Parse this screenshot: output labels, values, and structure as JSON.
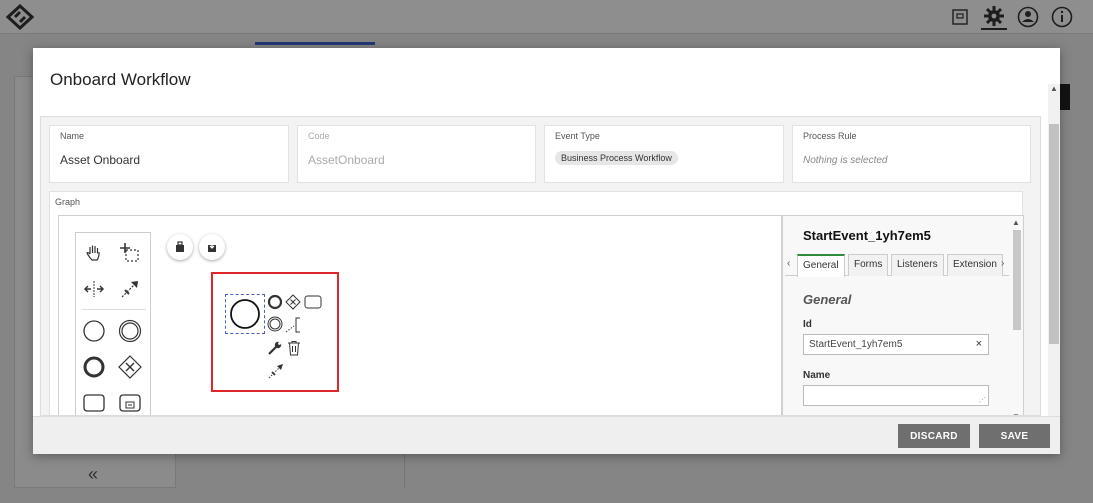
{
  "modal": {
    "title": "Onboard Workflow",
    "fields": {
      "name": {
        "label": "Name",
        "value": "Asset Onboard"
      },
      "code": {
        "label": "Code",
        "value": "AssetOnboard"
      },
      "event_type": {
        "label": "Event Type",
        "value": "Business Process Workflow"
      },
      "process_rule": {
        "label": "Process Rule",
        "placeholder": "Nothing is selected"
      }
    },
    "graph_label": "Graph"
  },
  "properties": {
    "title": "StartEvent_1yh7em5",
    "tabs": [
      {
        "label": "General",
        "active": true
      },
      {
        "label": "Forms",
        "active": false
      },
      {
        "label": "Listeners",
        "active": false
      },
      {
        "label": "Extension",
        "active": false
      }
    ],
    "section": "General",
    "id_label": "Id",
    "id_value": "StartEvent_1yh7em5",
    "name_label": "Name",
    "name_value": ""
  },
  "footer": {
    "discard_label": "DISCARD",
    "save_label": "SAVE"
  },
  "background": {
    "collapse_label": "«"
  },
  "colors": {
    "highlight": "#e0252b",
    "active_tab": "#2e8b3e",
    "subtab_underline": "#3a63c8",
    "button": "#6f6f6f"
  },
  "icons": [
    "hand-tool-icon",
    "lasso-tool-icon",
    "space-tool-icon",
    "global-connect-icon",
    "start-event-icon",
    "intermediate-event-icon",
    "end-event-icon",
    "gateway-icon",
    "task-icon",
    "subprocess-icon",
    "open-file-icon",
    "download-icon",
    "settings-icon",
    "user-icon",
    "info-icon",
    "wrench-icon",
    "trash-icon"
  ]
}
